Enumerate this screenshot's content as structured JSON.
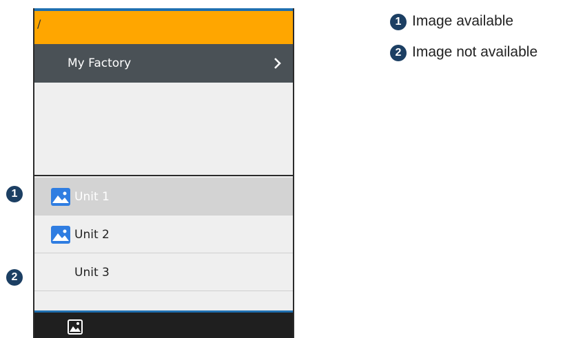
{
  "device": {
    "path_text": "/",
    "breadcrumb": {
      "label": "My Factory",
      "chevron_icon": "chevron-right-icon"
    },
    "units": [
      {
        "label": "Unit 1",
        "has_image": true,
        "selected": true
      },
      {
        "label": "Unit 2",
        "has_image": true,
        "selected": false
      },
      {
        "label": "Unit 3",
        "has_image": false,
        "selected": false
      }
    ],
    "bottom_bar": {
      "icon": "image-icon"
    }
  },
  "callouts": {
    "one": "1",
    "two": "2"
  },
  "legend": [
    {
      "number": "1",
      "text": "Image available"
    },
    {
      "number": "2",
      "text": "Image not available"
    }
  ],
  "colors": {
    "accent_orange": "#ffa600",
    "header_dark": "#4a5156",
    "badge_navy": "#1c3f63",
    "image_blue": "#2f7de1"
  }
}
